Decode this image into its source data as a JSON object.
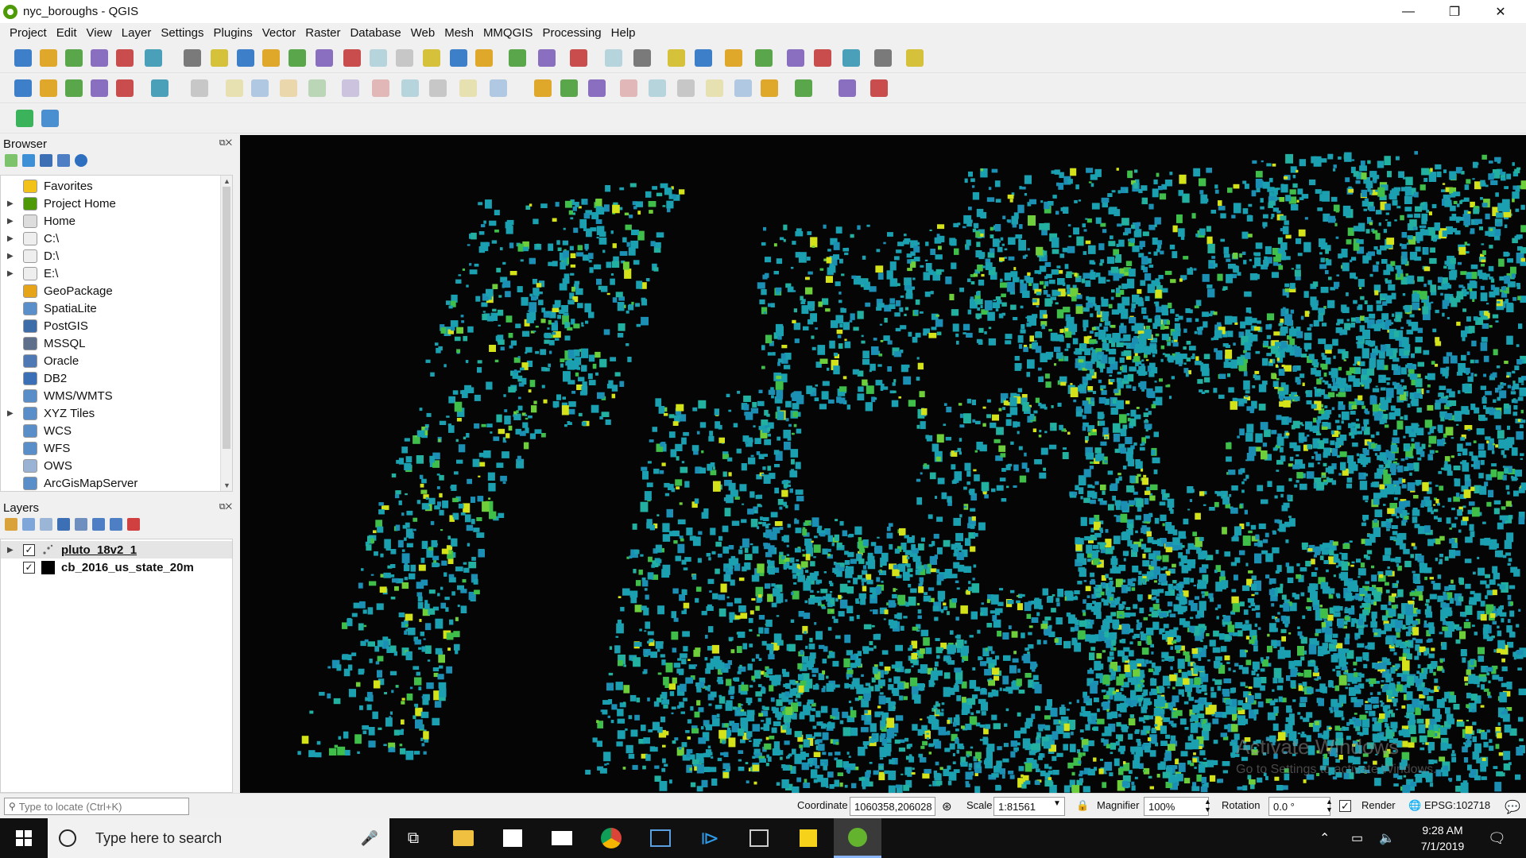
{
  "window": {
    "title": "nyc_boroughs - QGIS",
    "minimize": "—",
    "restore": "❐",
    "close": "✕"
  },
  "menu": [
    "Project",
    "Edit",
    "View",
    "Layer",
    "Settings",
    "Plugins",
    "Vector",
    "Raster",
    "Database",
    "Web",
    "Mesh",
    "MMQGIS",
    "Processing",
    "Help"
  ],
  "browser": {
    "title": "Browser",
    "items": [
      {
        "label": "Favorites",
        "icon": "star-icon",
        "color": "#f2c218",
        "arrow": ""
      },
      {
        "label": "Project Home",
        "icon": "project-home-icon",
        "color": "#4e9a06",
        "arrow": "▶"
      },
      {
        "label": "Home",
        "icon": "home-icon",
        "color": "#dddddd",
        "arrow": "▶"
      },
      {
        "label": "C:\\",
        "icon": "folder-icon",
        "color": "#eeeeee",
        "arrow": "▶"
      },
      {
        "label": "D:\\",
        "icon": "folder-icon",
        "color": "#eeeeee",
        "arrow": "▶"
      },
      {
        "label": "E:\\",
        "icon": "folder-icon",
        "color": "#eeeeee",
        "arrow": "▶"
      },
      {
        "label": "GeoPackage",
        "icon": "geopackage-icon",
        "color": "#e6a41a",
        "arrow": ""
      },
      {
        "label": "SpatiaLite",
        "icon": "spatialite-icon",
        "color": "#5b8fc9",
        "arrow": ""
      },
      {
        "label": "PostGIS",
        "icon": "postgis-icon",
        "color": "#3d6da8",
        "arrow": ""
      },
      {
        "label": "MSSQL",
        "icon": "mssql-icon",
        "color": "#5d6f8a",
        "arrow": ""
      },
      {
        "label": "Oracle",
        "icon": "oracle-icon",
        "color": "#4f79b5",
        "arrow": ""
      },
      {
        "label": "DB2",
        "icon": "db2-icon",
        "color": "#3b6fb6",
        "arrow": ""
      },
      {
        "label": "WMS/WMTS",
        "icon": "globe-icon",
        "color": "#5a8ec9",
        "arrow": ""
      },
      {
        "label": "XYZ Tiles",
        "icon": "globe-icon",
        "color": "#5a8ec9",
        "arrow": "▶"
      },
      {
        "label": "WCS",
        "icon": "globe-icon",
        "color": "#5a8ec9",
        "arrow": ""
      },
      {
        "label": "WFS",
        "icon": "globe-icon",
        "color": "#5a8ec9",
        "arrow": ""
      },
      {
        "label": "OWS",
        "icon": "globe-icon",
        "color": "#9ab3d4",
        "arrow": ""
      },
      {
        "label": "ArcGisMapServer",
        "icon": "globe-icon",
        "color": "#5a8ec9",
        "arrow": ""
      }
    ]
  },
  "layers": {
    "title": "Layers",
    "items": [
      {
        "label": "pluto_18v2_1",
        "checked": "✓",
        "arrow": "▶",
        "symbol": "points"
      },
      {
        "label": "cb_2016_us_state_20m",
        "checked": "✓",
        "arrow": "",
        "symbol": "fill"
      }
    ]
  },
  "map": {
    "watermark_line1": "Activate Windows",
    "watermark_line2": "Go to Settings to activate Windows."
  },
  "status": {
    "locator_placeholder": "Type to locate (Ctrl+K)",
    "coordinate_label": "Coordinate",
    "coordinate_value": "1060358,206028",
    "scale_label": "Scale",
    "scale_value": "1:81561",
    "magnifier_label": "Magnifier",
    "magnifier_value": "100%",
    "rotation_label": "Rotation",
    "rotation_value": "0.0 °",
    "render_label": "Render",
    "render_checked": "✓",
    "crs": "EPSG:102718"
  },
  "taskbar": {
    "search_placeholder": "Type here to search",
    "time": "9:28 AM",
    "date": "7/1/2019"
  },
  "colors": {
    "map_bg": "#050505",
    "lot_teal": "#1aa0b0",
    "lot_green": "#3fbf4a",
    "lot_yellow": "#d4e21a"
  }
}
